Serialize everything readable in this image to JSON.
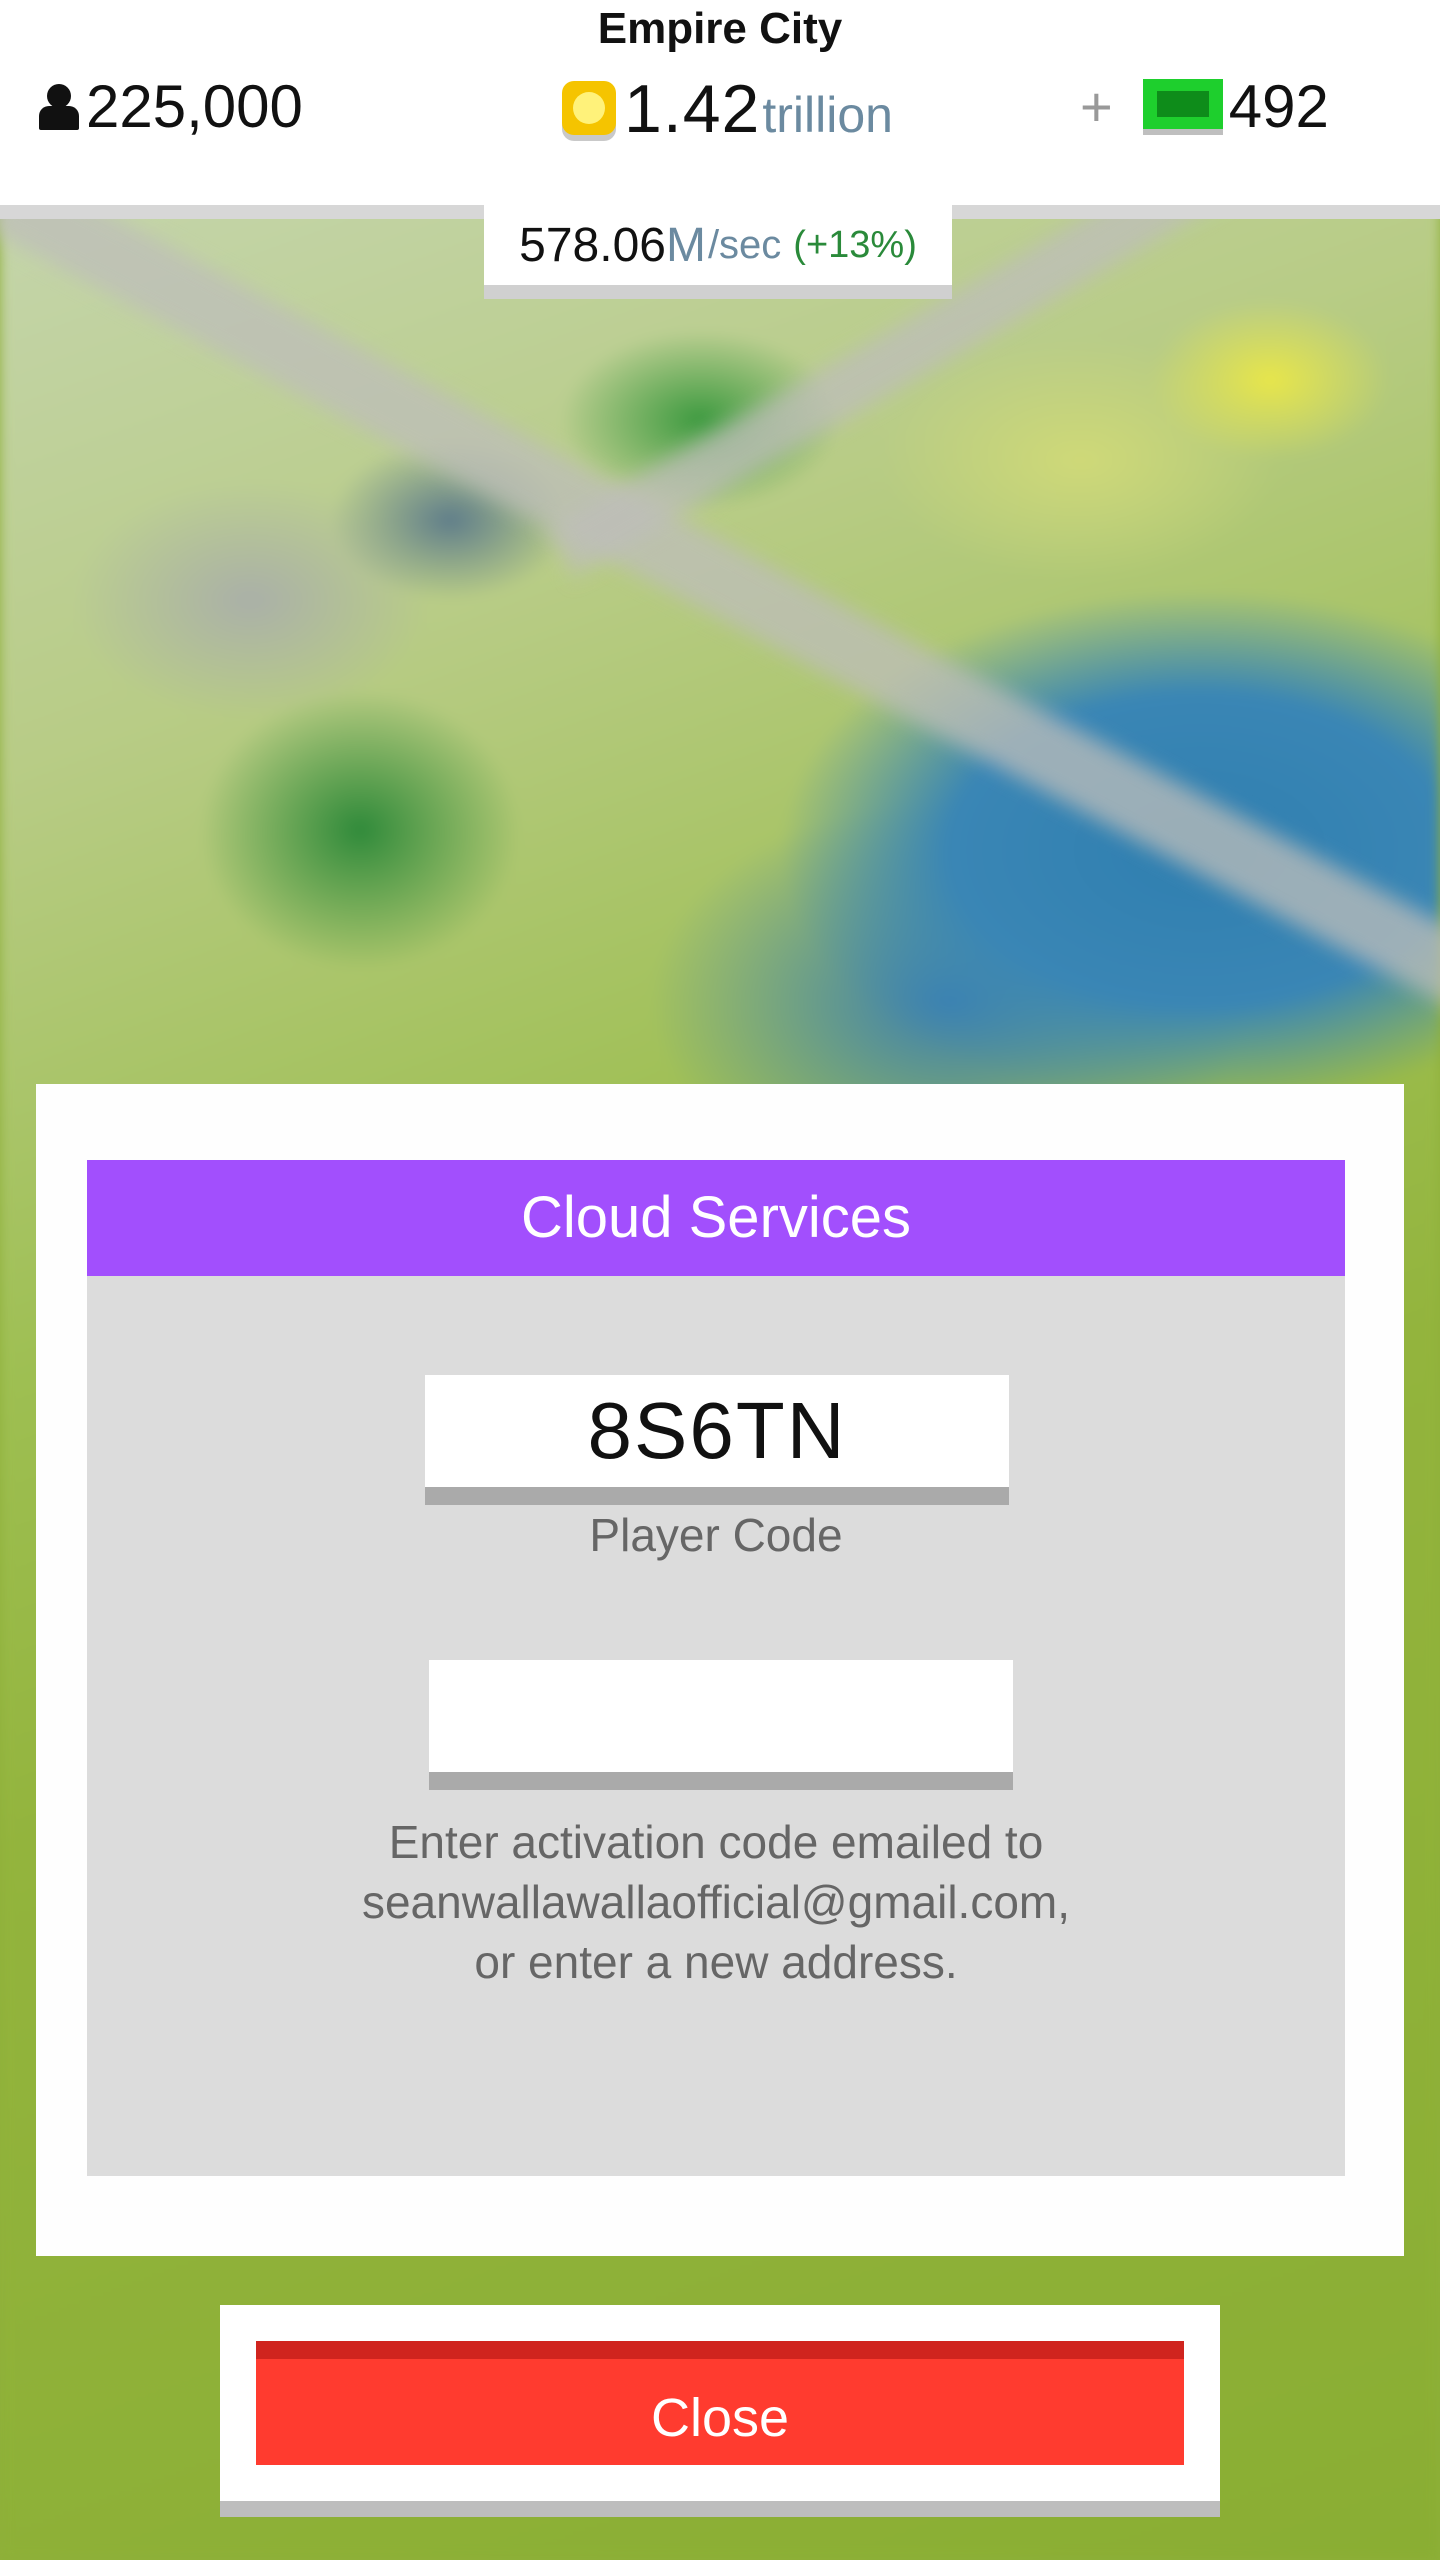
{
  "header": {
    "city_name": "Empire City",
    "population": "225,000",
    "coins_value": "1.42",
    "coins_unit": "trillion",
    "gems_plus": "+",
    "gems_value": "492"
  },
  "income": {
    "value": "578.06",
    "unit": "M",
    "per": "/sec",
    "bonus": "(+13%)"
  },
  "dialog": {
    "title": "Cloud Services",
    "player_code": "8S6TN",
    "player_code_label": "Player Code",
    "activation_input_value": "",
    "instructions": [
      "Enter activation code emailed to",
      "seanwallawallaofficial@gmail.com,",
      "or enter a new address."
    ]
  },
  "close_button": {
    "label": "Close"
  },
  "colors": {
    "header_purple": "#a24ffd",
    "close_red": "#ff3b2f",
    "gem_green": "#1ecf2d",
    "coin_gold": "#f5c400",
    "bonus_green": "#2a8a3a"
  },
  "icons": {
    "population": "person-icon",
    "coins": "coin-icon",
    "gems": "gem-icon"
  }
}
